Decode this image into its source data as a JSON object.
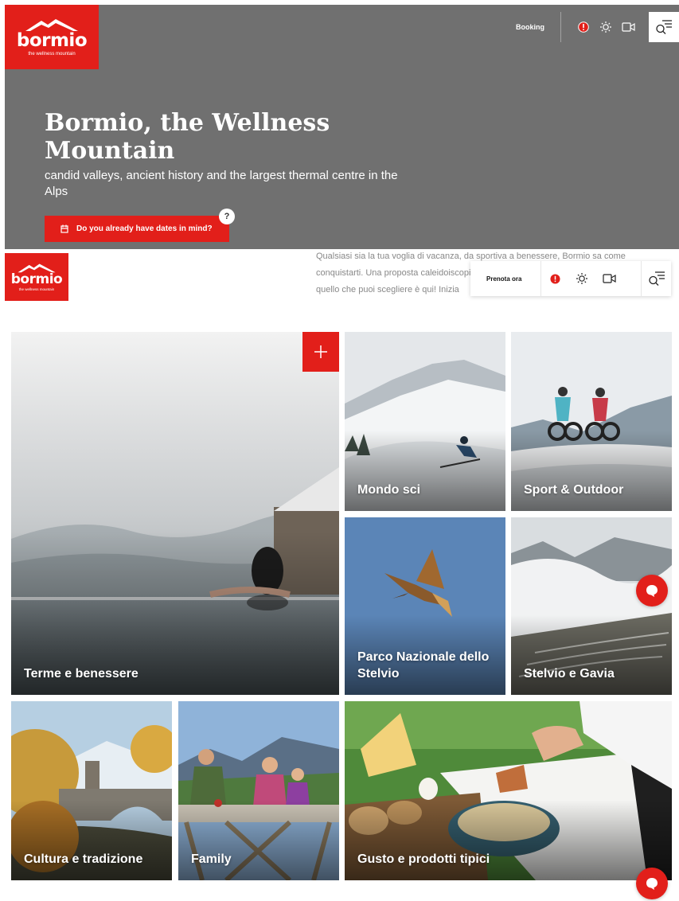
{
  "hero": {
    "logo": {
      "name": "bormio",
      "tagline": "the wellness mountain"
    },
    "booking_label": "Booking",
    "title": "Bormio, the Wellness Mountain",
    "subtitle": "candid valleys, ancient history and the largest thermal centre in the Alps",
    "dates_button": "Do you already have dates in mind?",
    "help_badge": "?"
  },
  "sticky_header": {
    "logo": {
      "name": "bormio",
      "tagline": "the wellness mountain"
    },
    "book_label": "Prenota ora"
  },
  "intro_text": [
    "Qualsiasi sia la tua voglia di vacanza, da sportiva a benessere, Bormio sa come",
    "conquistarti. Una proposta caleidoiscopica",
    "quello che puoi scegliere è qui! Inizia"
  ],
  "tiles": [
    {
      "label": "Terme e benessere"
    },
    {
      "label": "Mondo sci"
    },
    {
      "label": "Sport & Outdoor"
    },
    {
      "label": "Parco Nazionale dello Stelvio"
    },
    {
      "label": "Stelvio e Gavia"
    },
    {
      "label": "Cultura e tradizione"
    },
    {
      "label": "Family"
    },
    {
      "label": "Gusto e prodotti tipici"
    }
  ],
  "icons": [
    "mountain-logo-icon",
    "info-icon",
    "sun-weather-icon",
    "webcam-icon",
    "search-menu-icon",
    "calendar-icon",
    "plus-icon",
    "chat-icon"
  ],
  "colors": {
    "brand_red": "#e21f1a",
    "hero_grey": "#707070",
    "intro_text": "#888888"
  }
}
